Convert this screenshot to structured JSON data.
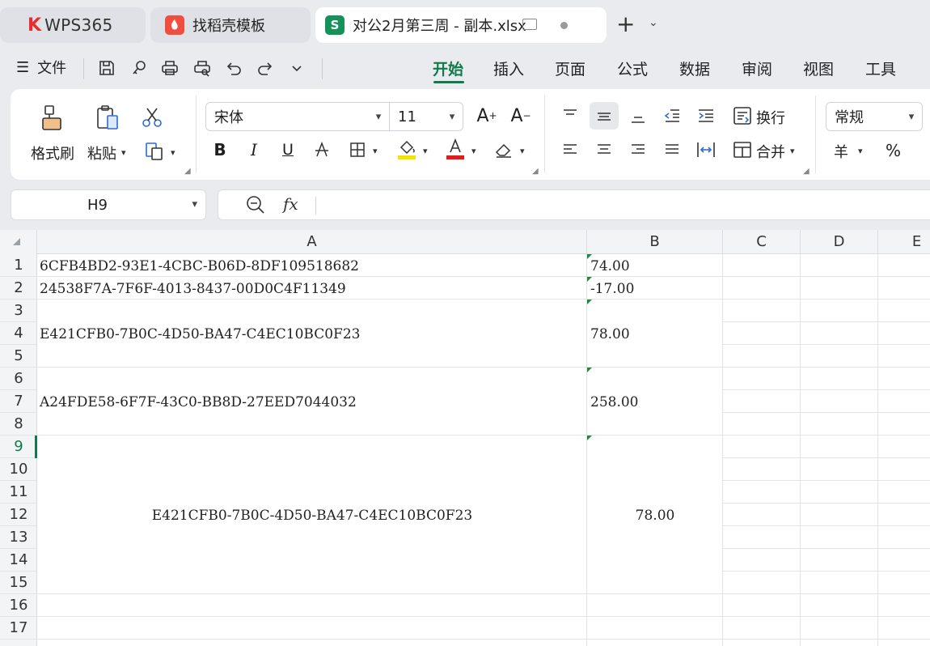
{
  "tabs": [
    {
      "label": "WPS365",
      "brand_mark": "K"
    },
    {
      "label": "找稻壳模板"
    },
    {
      "label": "对公2月第三周 - 副本.xlsx",
      "icon_letter": "S"
    }
  ],
  "menu": {
    "file": "文件",
    "tabs": [
      "开始",
      "插入",
      "页面",
      "公式",
      "数据",
      "审阅",
      "视图",
      "工具"
    ],
    "active_tab": "开始"
  },
  "ribbon": {
    "format_painter": "格式刷",
    "paste": "粘贴",
    "font_name": "宋体",
    "font_size": "11",
    "wrap": "换行",
    "merge": "合并",
    "number_format": "常规",
    "currency_symbol": "羊",
    "percent": "%",
    "bold": "B",
    "italic": "I",
    "underline": "U"
  },
  "formula_bar": {
    "cell_ref": "H9",
    "fx": "fx",
    "content": ""
  },
  "sheet": {
    "columns": [
      "A",
      "B",
      "C",
      "D",
      "E"
    ],
    "rows": [
      "1",
      "2",
      "3",
      "4",
      "5",
      "6",
      "7",
      "8",
      "9",
      "10",
      "11",
      "12",
      "13",
      "14",
      "15",
      "16",
      "17"
    ],
    "selected_row": "9",
    "cells": {
      "A1": "6CFB4BD2-93E1-4CBC-B06D-8DF109518682",
      "B1": "74.00",
      "A2": "24538F7A-7F6F-4013-8437-00D0C4F11349",
      "B2": "-17.00",
      "A3_5": "E421CFB0-7B0C-4D50-BA47-C4EC10BC0F23",
      "B3_5": "78.00",
      "A6_8": "A24FDE58-6F7F-43C0-BB8D-27EED7044032",
      "B6_8": "258.00",
      "A9_15": "E421CFB0-7B0C-4D50-BA47-C4EC10BC0F23",
      "B9_15": "78.00"
    }
  },
  "colors": {
    "accent": "#0f7b4a",
    "brand_red": "#e62e2e",
    "sheet_icon": "#17915a",
    "docer_icon": "#f04e3e"
  }
}
